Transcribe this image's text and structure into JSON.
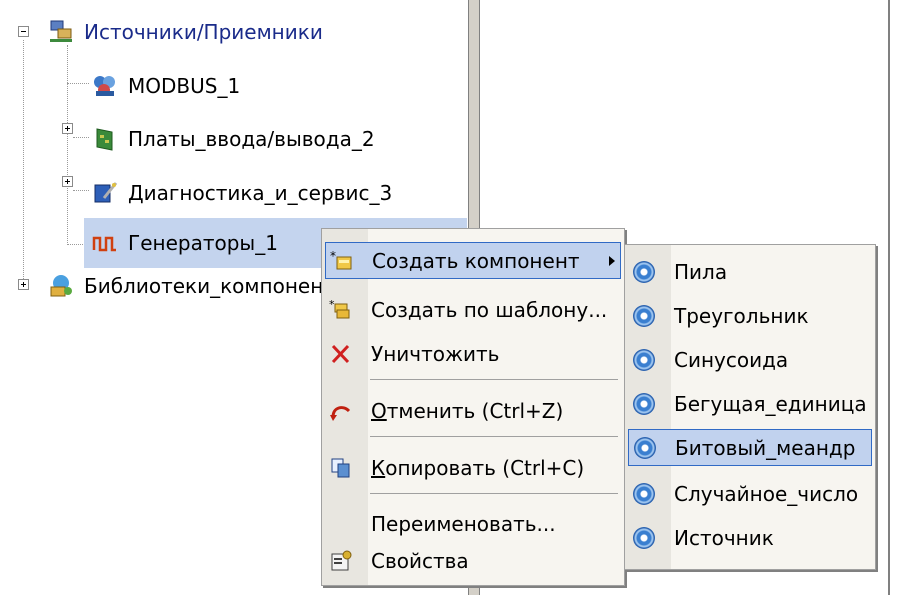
{
  "tree": {
    "items": [
      {
        "label": "Источники/Приемники",
        "icon": "network-icon"
      },
      {
        "label": "MODBUS_1",
        "icon": "modbus-icon"
      },
      {
        "label": "Платы_ввода/вывода_2",
        "icon": "board-icon"
      },
      {
        "label": "Диагностика_и_сервис_3",
        "icon": "diagnostics-icon"
      },
      {
        "label": "Генераторы_1",
        "icon": "generator-icon"
      },
      {
        "label": "Библиотеки_компонен",
        "icon": "library-icon"
      }
    ]
  },
  "context_menu": {
    "items": [
      {
        "label": "Создать компонент",
        "icon": "create-component-icon",
        "submenu": true
      },
      {
        "label": "Создать по шаблону...",
        "icon": "template-icon"
      },
      {
        "label": "Уничтожить",
        "icon": "delete-icon"
      },
      {
        "label_u": "О",
        "label_rest": "тменить (Ctrl+Z)",
        "icon": "undo-icon"
      },
      {
        "label_u": "К",
        "label_rest": "опировать (Ctrl+C)",
        "icon": "copy-icon"
      },
      {
        "label": "Переименовать...",
        "icon": ""
      },
      {
        "label": "Свойства",
        "icon": "properties-icon"
      }
    ]
  },
  "submenu": {
    "items": [
      {
        "label": "Пила",
        "icon": "component-icon"
      },
      {
        "label": "Треугольник",
        "icon": "component-icon"
      },
      {
        "label": "Синусоида",
        "icon": "component-icon"
      },
      {
        "label": "Бегущая_единица",
        "icon": "component-icon"
      },
      {
        "label": "Битовый_меандр",
        "icon": "component-icon"
      },
      {
        "label": "Случайное_число",
        "icon": "component-icon"
      },
      {
        "label": "Источник",
        "icon": "component-icon"
      }
    ],
    "highlighted_index": 4
  },
  "colors": {
    "selection": "#c4d4ee",
    "menu_highlight": "#c1d2ee",
    "menu_highlight_border": "#316ac5"
  }
}
